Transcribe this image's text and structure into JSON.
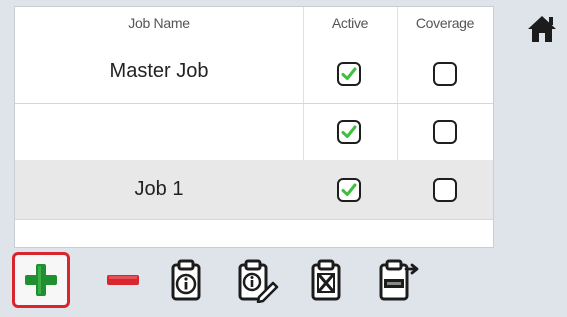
{
  "table": {
    "headers": {
      "job_name": "Job Name",
      "active": "Active",
      "coverage": "Coverage"
    },
    "rows": [
      {
        "name": "Master Job",
        "active": true,
        "coverage": false
      },
      {
        "name": "",
        "active": true,
        "coverage": false
      },
      {
        "name": "Job 1",
        "active": true,
        "coverage": false
      }
    ]
  },
  "toolbar": {
    "buttons": [
      {
        "icon": "add-icon",
        "selected": true
      },
      {
        "icon": "remove-icon",
        "selected": false
      },
      {
        "icon": "job-info-icon",
        "selected": false
      },
      {
        "icon": "job-edit-icon",
        "selected": false
      },
      {
        "icon": "job-delete-icon",
        "selected": false
      },
      {
        "icon": "job-export-icon",
        "selected": false
      }
    ]
  },
  "colors": {
    "check_green": "#3fbf3f",
    "add_green": "#1f8f2f",
    "remove_red": "#d7262d",
    "selected_outline": "#d7262d"
  }
}
